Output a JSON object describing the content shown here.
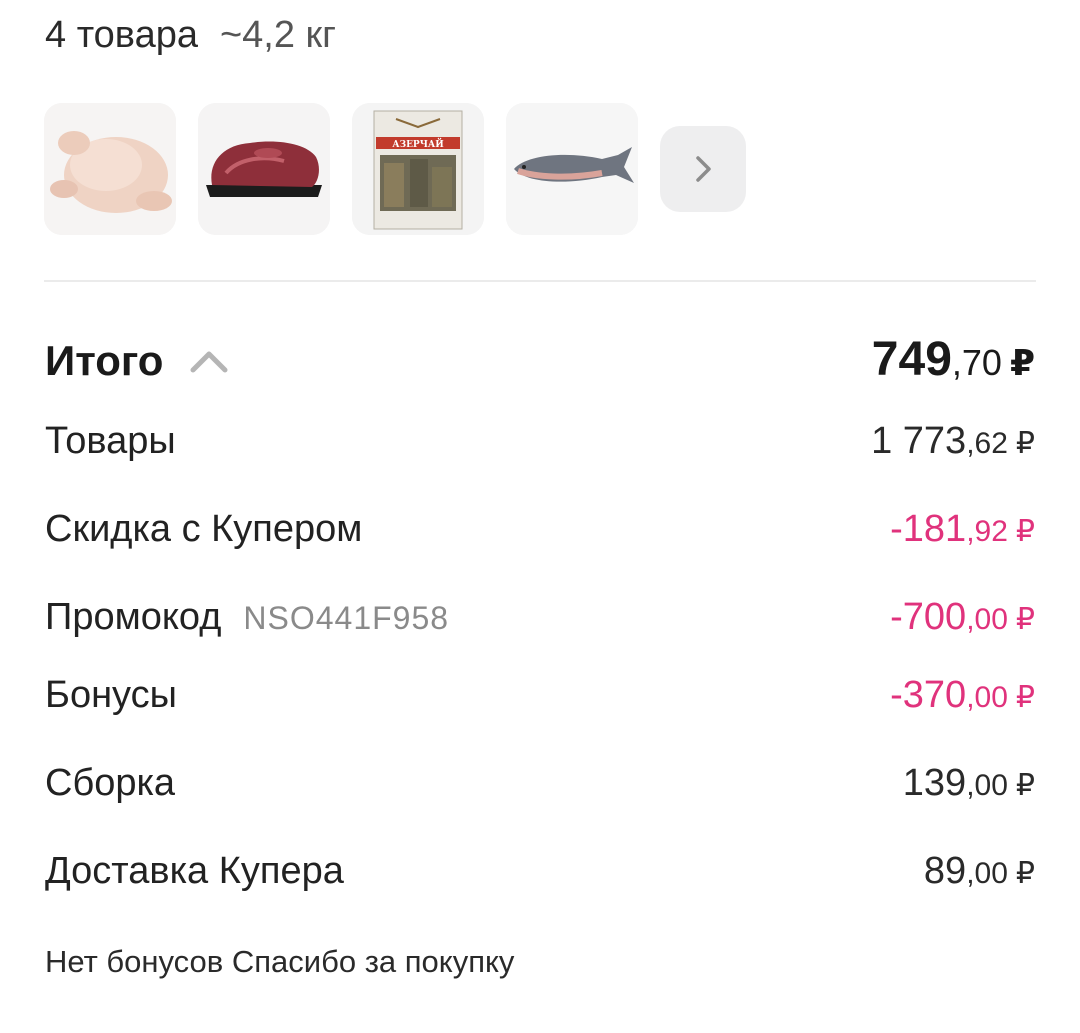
{
  "header": {
    "items_count": "4 товара",
    "weight": "~4,2 кг"
  },
  "thumbnails": [
    {
      "icon": "chicken-image"
    },
    {
      "icon": "beef-image"
    },
    {
      "icon": "tea-box-image",
      "brand_text": "АЗЕРЧАЙ"
    },
    {
      "icon": "fish-image"
    }
  ],
  "more_button": {
    "icon": "chevron-right-icon"
  },
  "totals": {
    "total": {
      "label": "Итого",
      "rub": "749",
      "kop": ",70",
      "currency": "₽",
      "icon": "chevron-up-icon"
    },
    "rows": [
      {
        "label": "Товары",
        "rub": "1 773",
        "kop": ",62",
        "currency": "₽"
      },
      {
        "label": "Скидка с Купером",
        "rub": "-181",
        "kop": ",92",
        "currency": "₽"
      },
      {
        "label": "Промокод",
        "code": "NSO441F958",
        "rub": "-700",
        "kop": ",00",
        "currency": "₽"
      },
      {
        "label": "Бонусы",
        "rub": "-370",
        "kop": ",00",
        "currency": "₽"
      },
      {
        "label": "Сборка",
        "rub": "139",
        "kop": ",00",
        "currency": "₽"
      },
      {
        "label": "Доставка Купера",
        "rub": "89",
        "kop": ",00",
        "currency": "₽"
      }
    ]
  },
  "footer_note": "Нет бонусов Спасибо за покупку",
  "colors": {
    "negative": "#e0327c",
    "thumb_bg": "#f1f1f2"
  }
}
